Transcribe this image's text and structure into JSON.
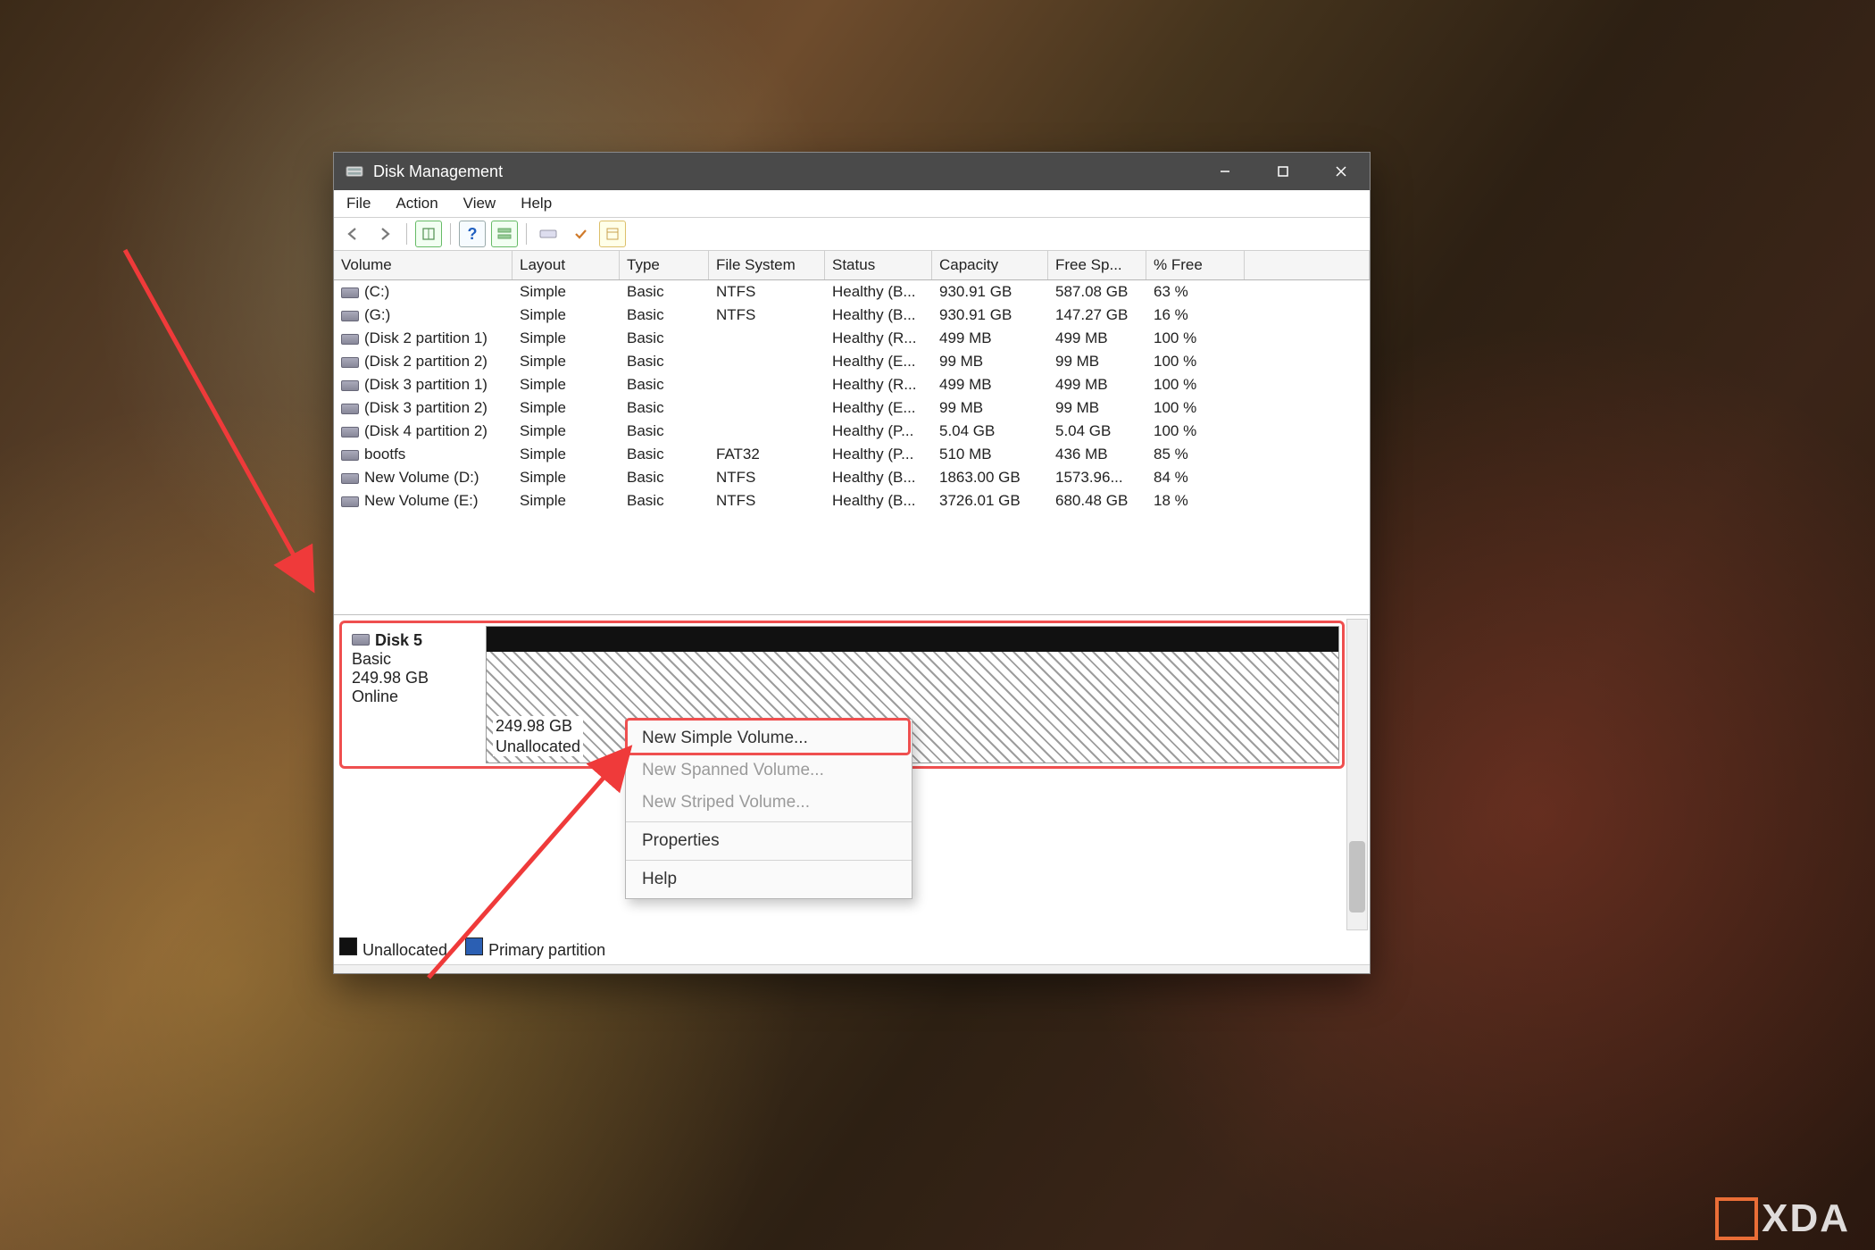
{
  "window": {
    "title": "Disk Management"
  },
  "menu": {
    "items": [
      "File",
      "Action",
      "View",
      "Help"
    ]
  },
  "columns": [
    "Volume",
    "Layout",
    "Type",
    "File System",
    "Status",
    "Capacity",
    "Free Sp...",
    "% Free"
  ],
  "volumes": [
    {
      "name": "(C:)",
      "layout": "Simple",
      "type": "Basic",
      "fs": "NTFS",
      "status": "Healthy (B...",
      "capacity": "930.91 GB",
      "free": "587.08 GB",
      "pct": "63 %"
    },
    {
      "name": "(G:)",
      "layout": "Simple",
      "type": "Basic",
      "fs": "NTFS",
      "status": "Healthy (B...",
      "capacity": "930.91 GB",
      "free": "147.27 GB",
      "pct": "16 %"
    },
    {
      "name": "(Disk 2 partition 1)",
      "layout": "Simple",
      "type": "Basic",
      "fs": "",
      "status": "Healthy (R...",
      "capacity": "499 MB",
      "free": "499 MB",
      "pct": "100 %"
    },
    {
      "name": "(Disk 2 partition 2)",
      "layout": "Simple",
      "type": "Basic",
      "fs": "",
      "status": "Healthy (E...",
      "capacity": "99 MB",
      "free": "99 MB",
      "pct": "100 %"
    },
    {
      "name": "(Disk 3 partition 1)",
      "layout": "Simple",
      "type": "Basic",
      "fs": "",
      "status": "Healthy (R...",
      "capacity": "499 MB",
      "free": "499 MB",
      "pct": "100 %"
    },
    {
      "name": "(Disk 3 partition 2)",
      "layout": "Simple",
      "type": "Basic",
      "fs": "",
      "status": "Healthy (E...",
      "capacity": "99 MB",
      "free": "99 MB",
      "pct": "100 %"
    },
    {
      "name": "(Disk 4 partition 2)",
      "layout": "Simple",
      "type": "Basic",
      "fs": "",
      "status": "Healthy (P...",
      "capacity": "5.04 GB",
      "free": "5.04 GB",
      "pct": "100 %"
    },
    {
      "name": "bootfs",
      "layout": "Simple",
      "type": "Basic",
      "fs": "FAT32",
      "status": "Healthy (P...",
      "capacity": "510 MB",
      "free": "436 MB",
      "pct": "85 %"
    },
    {
      "name": "New Volume (D:)",
      "layout": "Simple",
      "type": "Basic",
      "fs": "NTFS",
      "status": "Healthy (B...",
      "capacity": "1863.00 GB",
      "free": "1573.96...",
      "pct": "84 %"
    },
    {
      "name": "New Volume (E:)",
      "layout": "Simple",
      "type": "Basic",
      "fs": "NTFS",
      "status": "Healthy (B...",
      "capacity": "3726.01 GB",
      "free": "680.48 GB",
      "pct": "18 %"
    }
  ],
  "disk": {
    "name": "Disk 5",
    "type": "Basic",
    "capacity": "249.98 GB",
    "status": "Online",
    "unallocated_size": "249.98 GB",
    "unallocated_label": "Unallocated"
  },
  "context_menu": {
    "items": [
      {
        "label": "New Simple Volume...",
        "enabled": true
      },
      {
        "label": "New Spanned Volume...",
        "enabled": false
      },
      {
        "label": "New Striped Volume...",
        "enabled": false
      },
      {
        "label": "Properties",
        "enabled": true
      },
      {
        "label": "Help",
        "enabled": true
      }
    ]
  },
  "legend": {
    "unallocated": "Unallocated",
    "primary": "Primary partition"
  },
  "watermark": "XDA",
  "colors": {
    "highlight": "#ef4f4f"
  }
}
